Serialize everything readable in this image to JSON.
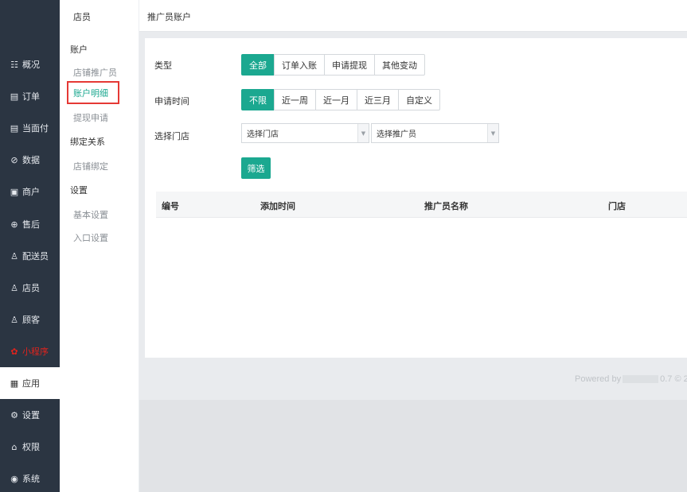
{
  "sidebar": {
    "items": [
      {
        "icon": "overview-icon",
        "glyph": "☷",
        "label": "概况"
      },
      {
        "icon": "order-icon",
        "glyph": "▤",
        "label": "订单"
      },
      {
        "icon": "facepay-icon",
        "glyph": "▤",
        "label": "当面付"
      },
      {
        "icon": "data-icon",
        "glyph": "⊘",
        "label": "数据"
      },
      {
        "icon": "merchant-icon",
        "glyph": "▣",
        "label": "商户"
      },
      {
        "icon": "aftersale-icon",
        "glyph": "⊕",
        "label": "售后"
      },
      {
        "icon": "courier-icon",
        "glyph": "♙",
        "label": "配送员"
      },
      {
        "icon": "clerk-icon",
        "glyph": "♙",
        "label": "店员"
      },
      {
        "icon": "customer-icon",
        "glyph": "♙",
        "label": "顾客"
      },
      {
        "icon": "miniprogram-icon",
        "glyph": "✿",
        "label": "小程序"
      },
      {
        "icon": "apps-icon",
        "glyph": "▦",
        "label": "应用"
      },
      {
        "icon": "settings-icon",
        "glyph": "⚙",
        "label": "设置"
      },
      {
        "icon": "permission-icon",
        "glyph": "⌂",
        "label": "权限"
      },
      {
        "icon": "system-icon",
        "glyph": "◉",
        "label": "系统"
      }
    ],
    "colors": {
      "bg": "#2b3542",
      "highlight": "#e0231d"
    }
  },
  "submenu": {
    "title": "店员",
    "group_account": "账户",
    "item_store_promoter": "店铺推广员",
    "item_account_detail": "账户明细",
    "item_withdraw": "提现申请",
    "group_binding": "绑定关系",
    "item_store_binding": "店铺绑定",
    "group_settings": "设置",
    "item_basic_settings": "基本设置",
    "item_entry_settings": "入口设置"
  },
  "header": {
    "title": "推广员账户"
  },
  "filters": {
    "type_label": "类型",
    "type_options": [
      "全部",
      "订单入账",
      "申请提现",
      "其他变动"
    ],
    "time_label": "申请时间",
    "time_options": [
      "不限",
      "近一周",
      "近一月",
      "近三月",
      "自定义"
    ],
    "store_label": "选择门店",
    "store_select": "选择门店",
    "promoter_select": "选择推广员",
    "filter_button": "筛选"
  },
  "table": {
    "columns": [
      "编号",
      "添加时间",
      "推广员名称",
      "门店"
    ]
  },
  "footer": {
    "powered_prefix": "Powered by",
    "powered_suffix": "0.7 © 2"
  },
  "accent_color": "#1ba890"
}
